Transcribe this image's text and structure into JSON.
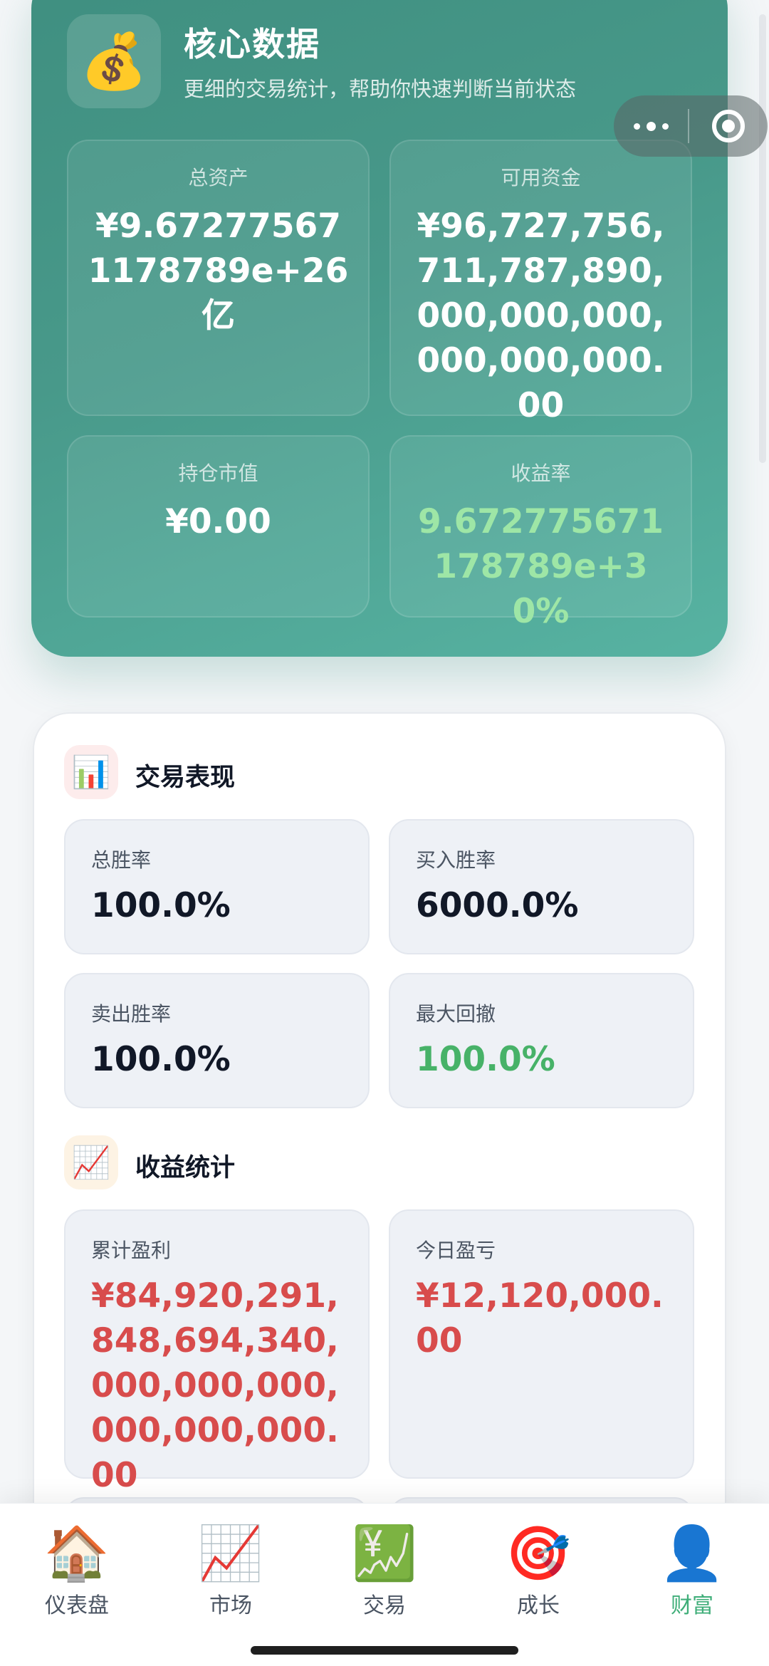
{
  "hero": {
    "icon": "money-bag-icon",
    "title": "核心数据",
    "subtitle": "更细的交易统计，帮助你快速判断当前状态",
    "stats": [
      {
        "label": "总资产",
        "value": "¥9.672775671178789e+26亿"
      },
      {
        "label": "可用资金",
        "value": "¥96,727,756,711,787,890,000,000,000,000,000,000.00"
      },
      {
        "label": "持仓市值",
        "value": "¥0.00"
      },
      {
        "label": "收益率",
        "value": "9.672775671178789e+30%",
        "color": "#9ee6a6"
      }
    ]
  },
  "capsule": {
    "more_icon": "more-dots-icon",
    "close_icon": "target-ring-icon"
  },
  "performance": {
    "icon": "bar-chart-icon",
    "title": "交易表现",
    "tiles": [
      {
        "label": "总胜率",
        "value": "100.0%"
      },
      {
        "label": "买入胜率",
        "value": "6000.0%"
      },
      {
        "label": "卖出胜率",
        "value": "100.0%"
      },
      {
        "label": "最大回撤",
        "value": "100.0%",
        "color": "#47b268"
      }
    ]
  },
  "profit": {
    "icon": "trend-chart-icon",
    "title": "收益统计",
    "tiles": [
      {
        "label": "累计盈利",
        "value": "¥84,920,291,848,694,340,000,000,000,000,000,000.00",
        "color": "#d84c4c"
      },
      {
        "label": "今日盈亏",
        "value": "¥12,120,000.00",
        "color": "#d84c4c"
      }
    ]
  },
  "tabbar": {
    "active_color": "#3fae79",
    "items": [
      {
        "label": "仪表盘",
        "icon": "house-icon",
        "glyph": "🏠"
      },
      {
        "label": "市场",
        "icon": "line-chart-icon",
        "glyph": "📈"
      },
      {
        "label": "交易",
        "icon": "yen-chart-icon",
        "glyph": "💹"
      },
      {
        "label": "成长",
        "icon": "dart-target-icon",
        "glyph": "🎯"
      },
      {
        "label": "财富",
        "icon": "user-silhouette-icon",
        "glyph": "👤",
        "active": true
      }
    ]
  }
}
